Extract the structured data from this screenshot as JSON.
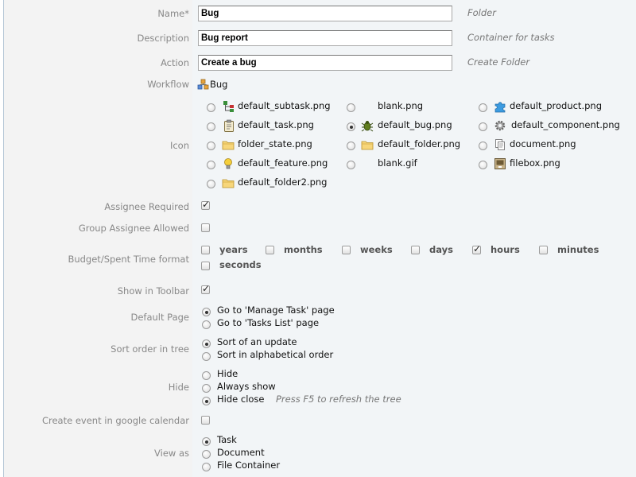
{
  "form": {
    "name": {
      "label": "Name*",
      "value": "Bug",
      "hint": "Folder"
    },
    "description": {
      "label": "Description",
      "value": "Bug report",
      "hint": "Container for tasks"
    },
    "action": {
      "label": "Action",
      "value": "Create a bug",
      "hint": "Create Folder"
    },
    "workflow": {
      "label": "Workflow",
      "value": "Bug"
    },
    "icon": {
      "label": "Icon",
      "options": [
        {
          "file": "default_subtask.png",
          "icon": "subtask-icon",
          "selected": false
        },
        {
          "file": "blank.png",
          "icon": "",
          "selected": false
        },
        {
          "file": "default_product.png",
          "icon": "puzzle-icon",
          "selected": false
        },
        {
          "file": "default_task.png",
          "icon": "clipboard-icon",
          "selected": false
        },
        {
          "file": "default_bug.png",
          "icon": "bug-icon",
          "selected": true
        },
        {
          "file": "default_component.png",
          "icon": "gear-icon",
          "selected": false
        },
        {
          "file": "folder_state.png",
          "icon": "folder-icon",
          "selected": false
        },
        {
          "file": "default_folder.png",
          "icon": "folder-icon",
          "selected": false
        },
        {
          "file": "document.png",
          "icon": "document-icon",
          "selected": false
        },
        {
          "file": "default_feature.png",
          "icon": "lightbulb-icon",
          "selected": false
        },
        {
          "file": "blank.gif",
          "icon": "",
          "selected": false
        },
        {
          "file": "filebox.png",
          "icon": "filebox-icon",
          "selected": false
        },
        {
          "file": "default_folder2.png",
          "icon": "folder-icon",
          "selected": false
        }
      ]
    },
    "assignee_required": {
      "label": "Assignee Required",
      "checked": true
    },
    "group_assignee_allowed": {
      "label": "Group Assignee Allowed",
      "checked": false
    },
    "time_format": {
      "label": "Budget/Spent Time format",
      "units": [
        {
          "name": "years",
          "checked": false
        },
        {
          "name": "months",
          "checked": false
        },
        {
          "name": "weeks",
          "checked": false
        },
        {
          "name": "days",
          "checked": false
        },
        {
          "name": "hours",
          "checked": true
        },
        {
          "name": "minutes",
          "checked": false
        },
        {
          "name": "seconds",
          "checked": false
        }
      ]
    },
    "show_in_toolbar": {
      "label": "Show in Toolbar",
      "checked": true
    },
    "default_page": {
      "label": "Default Page",
      "options": [
        {
          "text": "Go to 'Manage Task' page",
          "selected": true
        },
        {
          "text": "Go to 'Tasks List' page",
          "selected": false
        }
      ]
    },
    "sort_order": {
      "label": "Sort order in tree",
      "options": [
        {
          "text": "Sort of an update",
          "selected": true
        },
        {
          "text": "Sort in alphabetical order",
          "selected": false
        }
      ]
    },
    "hide": {
      "label": "Hide",
      "options": [
        {
          "text": "Hide",
          "selected": false
        },
        {
          "text": "Always show",
          "selected": false
        },
        {
          "text": "Hide close",
          "selected": true
        }
      ],
      "note": "Press F5 to refresh the tree"
    },
    "google_calendar": {
      "label": "Create event in google calendar",
      "checked": false
    },
    "view_as": {
      "label": "View as",
      "options": [
        {
          "text": "Task",
          "selected": true
        },
        {
          "text": "Document",
          "selected": false
        },
        {
          "text": "File Container",
          "selected": false
        }
      ]
    }
  },
  "colors": {
    "label_bg": "#f3f3f3",
    "value_bg": "#f2f5f7",
    "label_text": "#888888",
    "hint_text": "#777777"
  }
}
